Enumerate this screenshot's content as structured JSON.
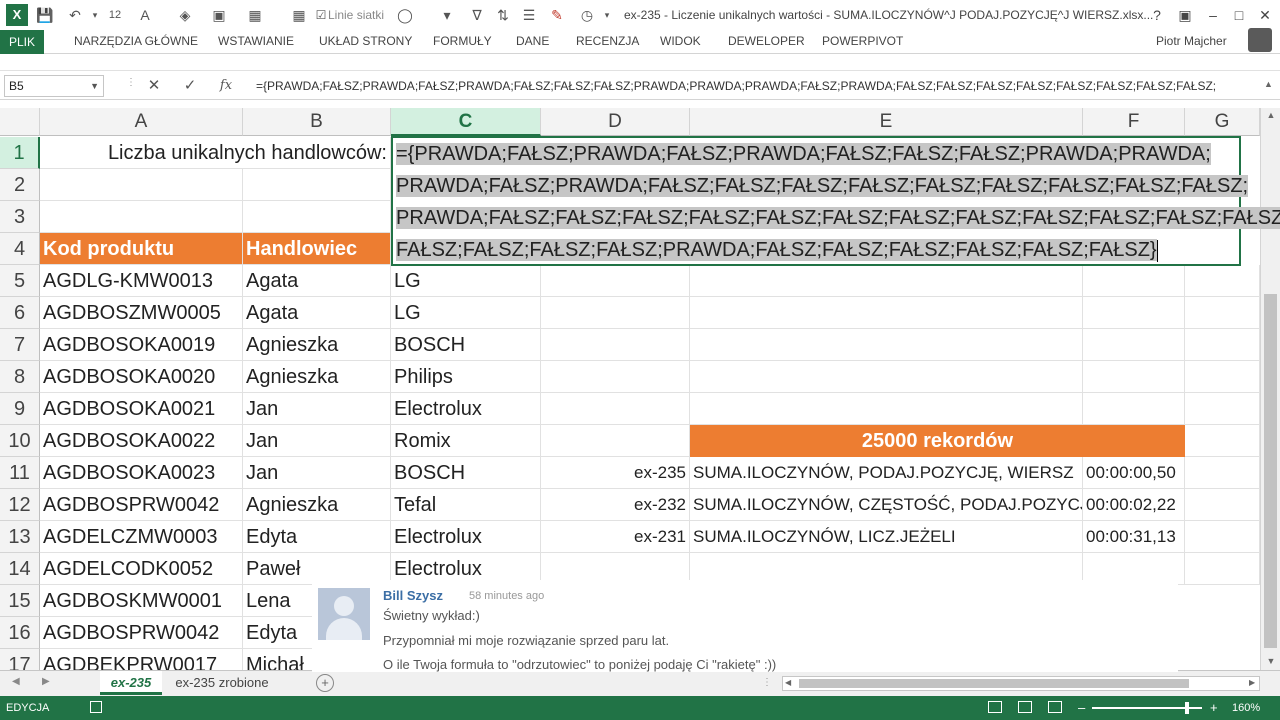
{
  "window": {
    "title": "ex-235 - Liczenie unikalnych wartości - SUMA.ILOCZYNÓW^J PODAJ.POZYCJĘ^J WIERSZ.xlsx...",
    "linie_siatki_label": "Linie siatki",
    "font_size_value": "12",
    "user": "Piotr Majcher",
    "help": "?"
  },
  "ribbon": {
    "file_tab": "PLIK",
    "tabs": [
      "NARZĘDZIA GŁÓWNE",
      "WSTAWIANIE",
      "UKŁAD STRONY",
      "FORMUŁY",
      "DANE",
      "RECENZJA",
      "WIDOK",
      "DEWELOPER",
      "POWERPIVOT"
    ]
  },
  "formula_bar": {
    "name_box": "B5",
    "fx_label": "fx",
    "formula": "={PRAWDA;FAŁSZ;PRAWDA;FAŁSZ;PRAWDA;FAŁSZ;FAŁSZ;FAŁSZ;PRAWDA;PRAWDA;PRAWDA;FAŁSZ;PRAWDA;FAŁSZ;FAŁSZ;FAŁSZ;FAŁSZ;FAŁSZ;FAŁSZ;FAŁSZ;FAŁSZ;"
  },
  "columns": [
    "A",
    "B",
    "C",
    "D",
    "E",
    "F",
    "G"
  ],
  "rows": [
    "1",
    "2",
    "3",
    "4",
    "5",
    "6",
    "7",
    "8",
    "9",
    "10",
    "11",
    "12",
    "13",
    "14",
    "15",
    "16",
    "17"
  ],
  "cells": {
    "a1": "Liczba unikalnych handlowców:",
    "a4": "Kod produktu",
    "b4": "Handlowiec",
    "data": [
      {
        "a": "AGDLG-KMW0013",
        "b": "Agata",
        "c": "LG"
      },
      {
        "a": "AGDBOSZMW0005",
        "b": "Agata",
        "c": "LG"
      },
      {
        "a": "AGDBOSOKA0019",
        "b": "Agnieszka",
        "c": "BOSCH"
      },
      {
        "a": "AGDBOSOKA0020",
        "b": "Agnieszka",
        "c": "Philips"
      },
      {
        "a": "AGDBOSOKA0021",
        "b": "Jan",
        "c": "Electrolux"
      },
      {
        "a": "AGDBOSOKA0022",
        "b": "Jan",
        "c": "Romix"
      },
      {
        "a": "AGDBOSOKA0023",
        "b": "Jan",
        "c": "BOSCH"
      },
      {
        "a": "AGDBOSPRW0042",
        "b": "Agnieszka",
        "c": "Tefal"
      },
      {
        "a": "AGDELCZMW0003",
        "b": "Edyta",
        "c": "Electrolux"
      },
      {
        "a": "AGDELCODK0052",
        "b": "Paweł",
        "c": "Electrolux"
      },
      {
        "a": "AGDBOSKMW0001",
        "b": "Lena",
        "c": ""
      },
      {
        "a": "AGDBOSPRW0042",
        "b": "Edyta",
        "c": ""
      },
      {
        "a": "AGDBEKPRW0017",
        "b": "Michał",
        "c": ""
      }
    ]
  },
  "editor_lines": [
    "={PRAWDA;FAŁSZ;PRAWDA;FAŁSZ;PRAWDA;FAŁSZ;FAŁSZ;FAŁSZ;PRAWDA;PRAWDA;",
    "PRAWDA;FAŁSZ;PRAWDA;FAŁSZ;FAŁSZ;FAŁSZ;FAŁSZ;FAŁSZ;FAŁSZ;FAŁSZ;FAŁSZ;FAŁSZ;",
    "PRAWDA;FAŁSZ;FAŁSZ;FAŁSZ;FAŁSZ;FAŁSZ;FAŁSZ;FAŁSZ;FAŁSZ;FAŁSZ;FAŁSZ;FAŁSZ;FAŁSZ;",
    "FAŁSZ;FAŁSZ;FAŁSZ;FAŁSZ;PRAWDA;FAŁSZ;FAŁSZ;FAŁSZ;FAŁSZ;FAŁSZ;FAŁSZ}"
  ],
  "comparison": {
    "banner": "25000 rekordów",
    "rows": [
      {
        "id": "ex-235",
        "formula": "SUMA.ILOCZYNÓW, PODAJ.POZYCJĘ, WIERSZ",
        "time": "00:00:00,50"
      },
      {
        "id": "ex-232",
        "formula": "SUMA.ILOCZYNÓW, CZĘSTOŚĆ, PODAJ.POZYCJĘ",
        "time": "00:00:02,22"
      },
      {
        "id": "ex-231",
        "formula": "SUMA.ILOCZYNÓW, LICZ.JEŻELI",
        "time": "00:00:31,13"
      }
    ]
  },
  "comment": {
    "author": "Bill Szysz",
    "time": "58 minutes ago",
    "lines": [
      "Świetny wykład:)",
      "Przypomniał mi moje rozwiązanie sprzed paru lat.",
      "O ile Twoja formuła to \"odrzutowiec\" to poniżej podaję Ci \"rakietę\" :))"
    ]
  },
  "sheets": {
    "tabs": [
      "ex-235",
      "ex-235 zrobione"
    ],
    "active": "ex-235"
  },
  "status": {
    "mode": "EDYCJA",
    "zoom": "160%"
  },
  "colors": {
    "excel_green": "#217346",
    "orange_header": "#ed7d31",
    "selection_gray": "#c6c6c6"
  }
}
